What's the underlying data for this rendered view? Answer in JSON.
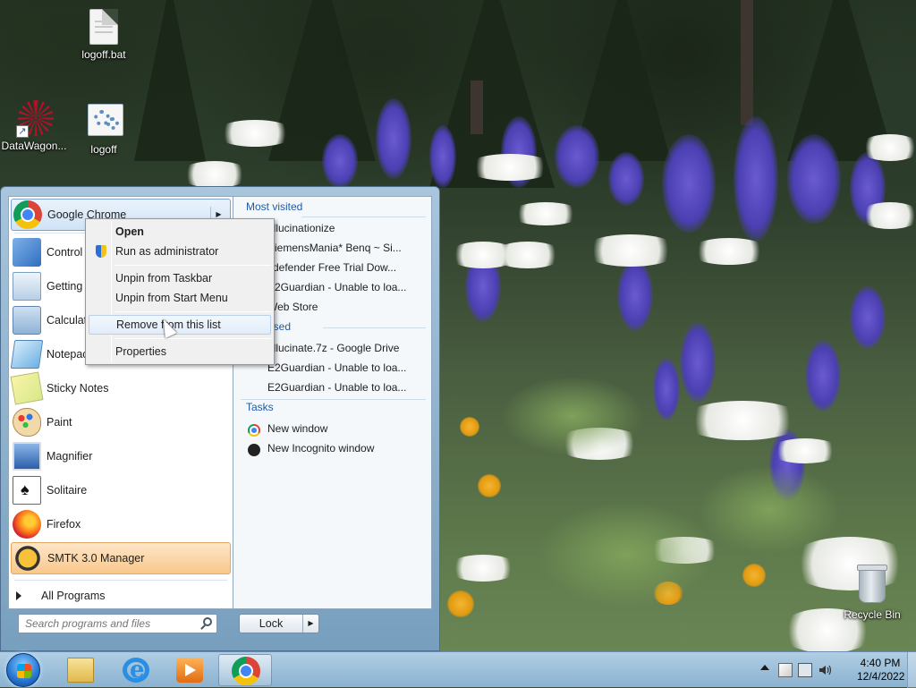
{
  "desktop": {
    "icons": [
      {
        "label": "logoff.bat"
      },
      {
        "label": "DataWagon..."
      },
      {
        "label": "logoff"
      }
    ],
    "recycle_bin": "Recycle Bin"
  },
  "start_menu": {
    "pinned": [
      {
        "label": "Google Chrome",
        "icon": "chrome-icon"
      },
      {
        "label": "Control",
        "icon": "control-panel-icon"
      },
      {
        "label": "Getting",
        "icon": "getting-started-icon"
      },
      {
        "label": "Calculat",
        "icon": "calculator-icon"
      },
      {
        "label": "Notepac",
        "icon": "notepad-icon"
      },
      {
        "label": "Sticky Notes",
        "icon": "sticky-notes-icon"
      },
      {
        "label": "Paint",
        "icon": "paint-icon"
      },
      {
        "label": "Magnifier",
        "icon": "magnifier-icon"
      },
      {
        "label": "Solitaire",
        "icon": "solitaire-icon"
      },
      {
        "label": "Firefox",
        "icon": "firefox-icon"
      },
      {
        "label": "SMTK 3.0 Manager",
        "icon": "smtk-icon"
      }
    ],
    "all_programs": "All Programs",
    "search_placeholder": "Search programs and files",
    "lock_label": "Lock",
    "jump_list": {
      "most_visited_title": "Most visited",
      "most_visited": [
        "allucinationize",
        "SiemensMania* Benq ~ Si...",
        "itdefender Free Trial Dow...",
        "E2Guardian - Unable to loa...",
        "Web Store"
      ],
      "recently_closed_title": "tly closed",
      "recently_closed": [
        "allucinate.7z - Google Drive",
        "E2Guardian - Unable to loa...",
        "E2Guardian - Unable to loa..."
      ],
      "tasks_title": "Tasks",
      "tasks": [
        {
          "label": "New window",
          "icon": "chrome-icon"
        },
        {
          "label": "New Incognito window",
          "icon": "incognito-icon"
        }
      ]
    }
  },
  "context_menu": {
    "items": [
      "Open",
      "Run as administrator",
      "Unpin from Taskbar",
      "Unpin from Start Menu",
      "Remove from this list",
      "Properties"
    ]
  },
  "taskbar": {
    "pinned": [
      "file-explorer-icon",
      "internet-explorer-icon",
      "media-player-icon",
      "chrome-icon"
    ],
    "clock_time": "4:40 PM",
    "clock_date": "12/4/2022"
  },
  "colors": {
    "accent": "#1e5aa8",
    "hover_orange": "#f9c88c"
  }
}
